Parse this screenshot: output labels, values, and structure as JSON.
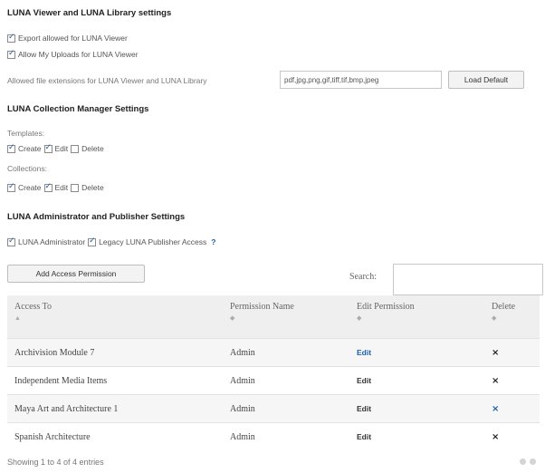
{
  "viewer_section": {
    "title": "LUNA Viewer and LUNA Library settings",
    "export_label": "Export allowed for LUNA Viewer",
    "export_checked": true,
    "uploads_label": "Allow My Uploads for LUNA Viewer",
    "uploads_checked": true,
    "extensions_label": "Allowed file extensions for LUNA Viewer and LUNA Library",
    "extensions_value": "pdf,jpg,png,gif,tiff,tif,bmp,jpeg",
    "load_default_label": "Load Default"
  },
  "collection_manager": {
    "title": "LUNA Collection Manager Settings",
    "templates_label": "Templates:",
    "collections_label": "Collections:",
    "create_label": "Create",
    "edit_label": "Edit",
    "delete_label": "Delete"
  },
  "admin_section": {
    "title": "LUNA Administrator and Publisher Settings",
    "admin_label": "LUNA Administrator",
    "legacy_label": "Legacy LUNA Publisher Access",
    "help": "?"
  },
  "controls": {
    "add_permission_label": "Add Access Permission",
    "search_label": "Search:",
    "search_value": ""
  },
  "table": {
    "headers": {
      "access_to": "Access To",
      "permission_name": "Permission Name",
      "edit_permission": "Edit Permission",
      "delete": "Delete"
    },
    "rows": [
      {
        "access_to": "Archivision Module 7",
        "permission_name": "Admin",
        "edit": "Edit",
        "delete": "×"
      },
      {
        "access_to": "Independent Media Items",
        "permission_name": "Admin",
        "edit": "Edit",
        "delete": "×"
      },
      {
        "access_to": "Maya Art and Architecture 1",
        "permission_name": "Admin",
        "edit": "Edit",
        "delete": "×"
      },
      {
        "access_to": "Spanish Architecture",
        "permission_name": "Admin",
        "edit": "Edit",
        "delete": "×"
      }
    ]
  },
  "footer": {
    "info": "Showing 1 to 4 of 4 entries"
  },
  "colors": {
    "accent": "#1c5fa8",
    "header_bg": "#efefef"
  }
}
